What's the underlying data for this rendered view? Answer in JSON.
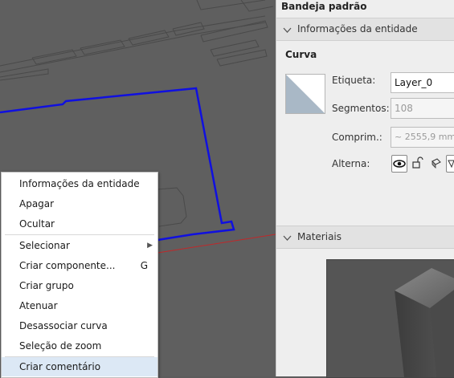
{
  "context_menu": {
    "items": [
      {
        "label": "Informações da entidade"
      },
      {
        "label": "Apagar"
      },
      {
        "label": "Ocultar"
      },
      {
        "label": "Selecionar"
      },
      {
        "label": "Criar componente...",
        "shortcut": "G"
      },
      {
        "label": "Criar grupo"
      },
      {
        "label": "Atenuar"
      },
      {
        "label": "Desassociar curva"
      },
      {
        "label": "Seleção de zoom"
      },
      {
        "label": "Criar comentário"
      }
    ]
  },
  "tray": {
    "title": "Bandeja padrão",
    "entity_panel": {
      "title": "Informações da entidade",
      "entity_name": "Curva",
      "tag_label": "Etiqueta:",
      "tag_value": "Layer_0",
      "segments_label": "Segmentos:",
      "segments_value": "108",
      "length_label": "Comprim.:",
      "length_value": "~ 2555,9 mm",
      "toggles_label": "Alterna:"
    },
    "materials_panel": {
      "title": "Materiais"
    }
  },
  "colors": {
    "selection": "#1010e0",
    "axis_red": "#c0282a",
    "menu_hover": "#dce8f5"
  }
}
